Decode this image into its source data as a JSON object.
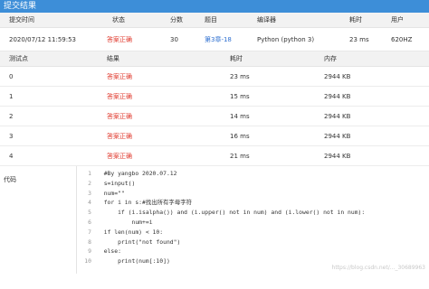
{
  "title": "提交结果",
  "summary_header": {
    "submit_time": "提交时间",
    "status": "状态",
    "score": "分数",
    "problem": "题目",
    "compiler": "编译器",
    "time": "耗时",
    "user": "用户"
  },
  "summary": {
    "submit_time": "2020/07/12 11:59:53",
    "status": "答案正确",
    "score": "30",
    "problem": "第3章-18",
    "compiler": "Python (python 3)",
    "time": "23 ms",
    "user": "620HZ"
  },
  "tests_header": {
    "point": "测试点",
    "result": "结果",
    "time": "耗时",
    "memory": "内存"
  },
  "tests": [
    {
      "point": "0",
      "result": "答案正确",
      "time": "23 ms",
      "memory": "2944 KB"
    },
    {
      "point": "1",
      "result": "答案正确",
      "time": "15 ms",
      "memory": "2944 KB"
    },
    {
      "point": "2",
      "result": "答案正确",
      "time": "14 ms",
      "memory": "2944 KB"
    },
    {
      "point": "3",
      "result": "答案正确",
      "time": "16 ms",
      "memory": "2944 KB"
    },
    {
      "point": "4",
      "result": "答案正确",
      "time": "21 ms",
      "memory": "2944 KB"
    }
  ],
  "code_label": "代码",
  "code": [
    {
      "n": "1",
      "text": "  #By yangbo 2020.07.12"
    },
    {
      "n": "2",
      "text": "  s=input()"
    },
    {
      "n": "3",
      "text": "  num=\"\""
    },
    {
      "n": "4",
      "text": "  for i in s:#找出所有字母字符"
    },
    {
      "n": "5",
      "text": "      if (i.isalpha()) and (i.upper() not in num) and (i.lower() not in num):"
    },
    {
      "n": "6",
      "text": "          num+=i"
    },
    {
      "n": "7",
      "text": "  if len(num) < 10:"
    },
    {
      "n": "8",
      "text": "      print(\"not found\")"
    },
    {
      "n": "9",
      "text": "  else:"
    },
    {
      "n": "10",
      "text": "      print(num[:10])"
    }
  ],
  "watermark": "https://blog.csdn.net/..._30689963"
}
